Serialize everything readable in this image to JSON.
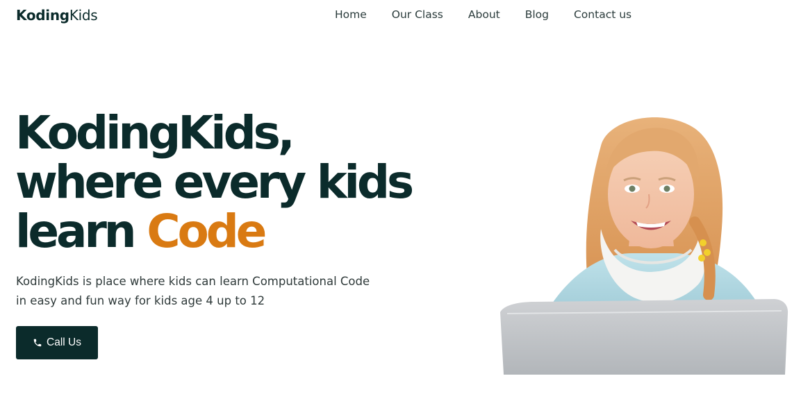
{
  "header": {
    "logo": {
      "bold": "Koding",
      "light": "Kids"
    },
    "nav": [
      {
        "label": "Home"
      },
      {
        "label": "Our Class"
      },
      {
        "label": "About"
      },
      {
        "label": "Blog"
      },
      {
        "label": "Contact us"
      }
    ]
  },
  "hero": {
    "title_lines": [
      "KodingKids,",
      "where every kids"
    ],
    "title_last_prefix": "learn ",
    "title_accent": "Code",
    "subtitle_lines": [
      "KodingKids is place where kids can learn Computational Code",
      "in easy and fun way for kids age 4 up to 12"
    ],
    "cta": {
      "label": "Call Us",
      "icon": "phone-icon"
    },
    "image": {
      "icon": "child-with-laptop-illustration"
    }
  },
  "colors": {
    "primary": "#0b2b2b",
    "accent": "#d97a12",
    "text_muted": "#2f3a3a",
    "background": "#ffffff"
  }
}
